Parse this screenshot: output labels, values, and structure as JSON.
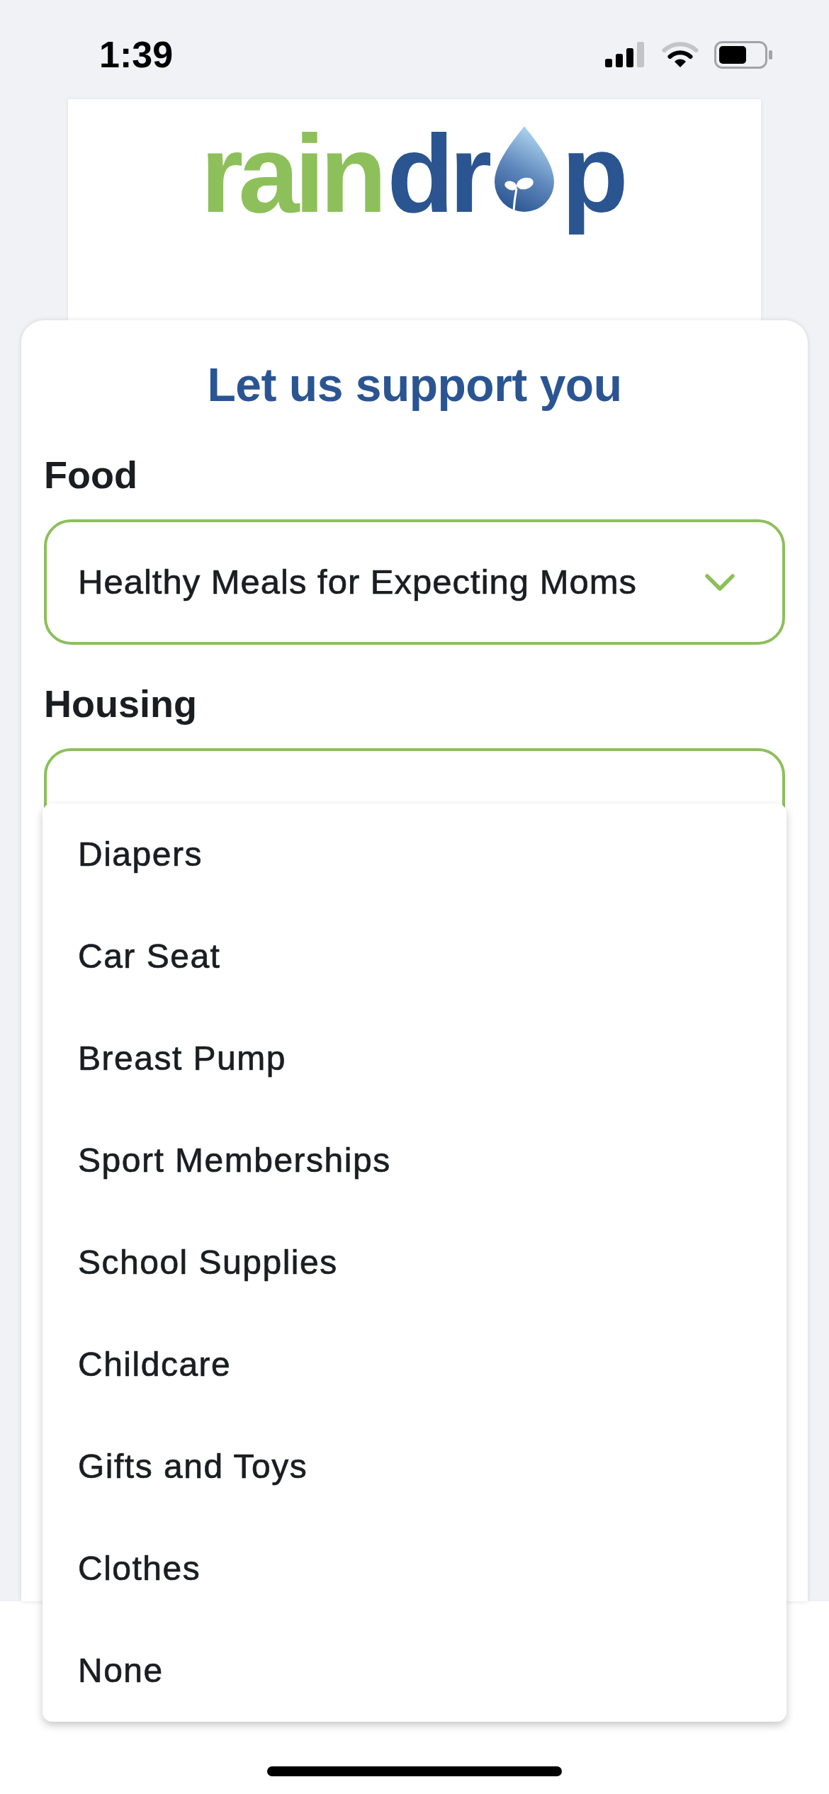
{
  "status_bar": {
    "time": "1:39"
  },
  "logo": {
    "parts": [
      {
        "kind": "text",
        "text": "rain",
        "color": "#8dc05a"
      },
      {
        "kind": "text",
        "text": "dr",
        "color": "#2b5590"
      },
      {
        "kind": "drop"
      },
      {
        "kind": "text",
        "text": "p",
        "color": "#2b5590"
      }
    ]
  },
  "form": {
    "title": "Let us support you",
    "fields": [
      {
        "label": "Food",
        "value": "Healthy Meals for Expecting Moms",
        "expanded": false
      },
      {
        "label": "Housing",
        "expanded": true,
        "options": [
          {
            "text": "Diapers",
            "selected": false
          },
          {
            "text": "Car Seat",
            "selected": false
          },
          {
            "text": "Breast Pump",
            "selected": false
          },
          {
            "text": "Sport Memberships",
            "selected": false
          },
          {
            "text": "School Supplies",
            "selected": false
          },
          {
            "text": "Childcare",
            "selected": false
          },
          {
            "text": "Gifts and Toys",
            "selected": false
          },
          {
            "text": "Clothes",
            "selected": false
          },
          {
            "text": "None",
            "selected": false
          }
        ]
      }
    ]
  }
}
